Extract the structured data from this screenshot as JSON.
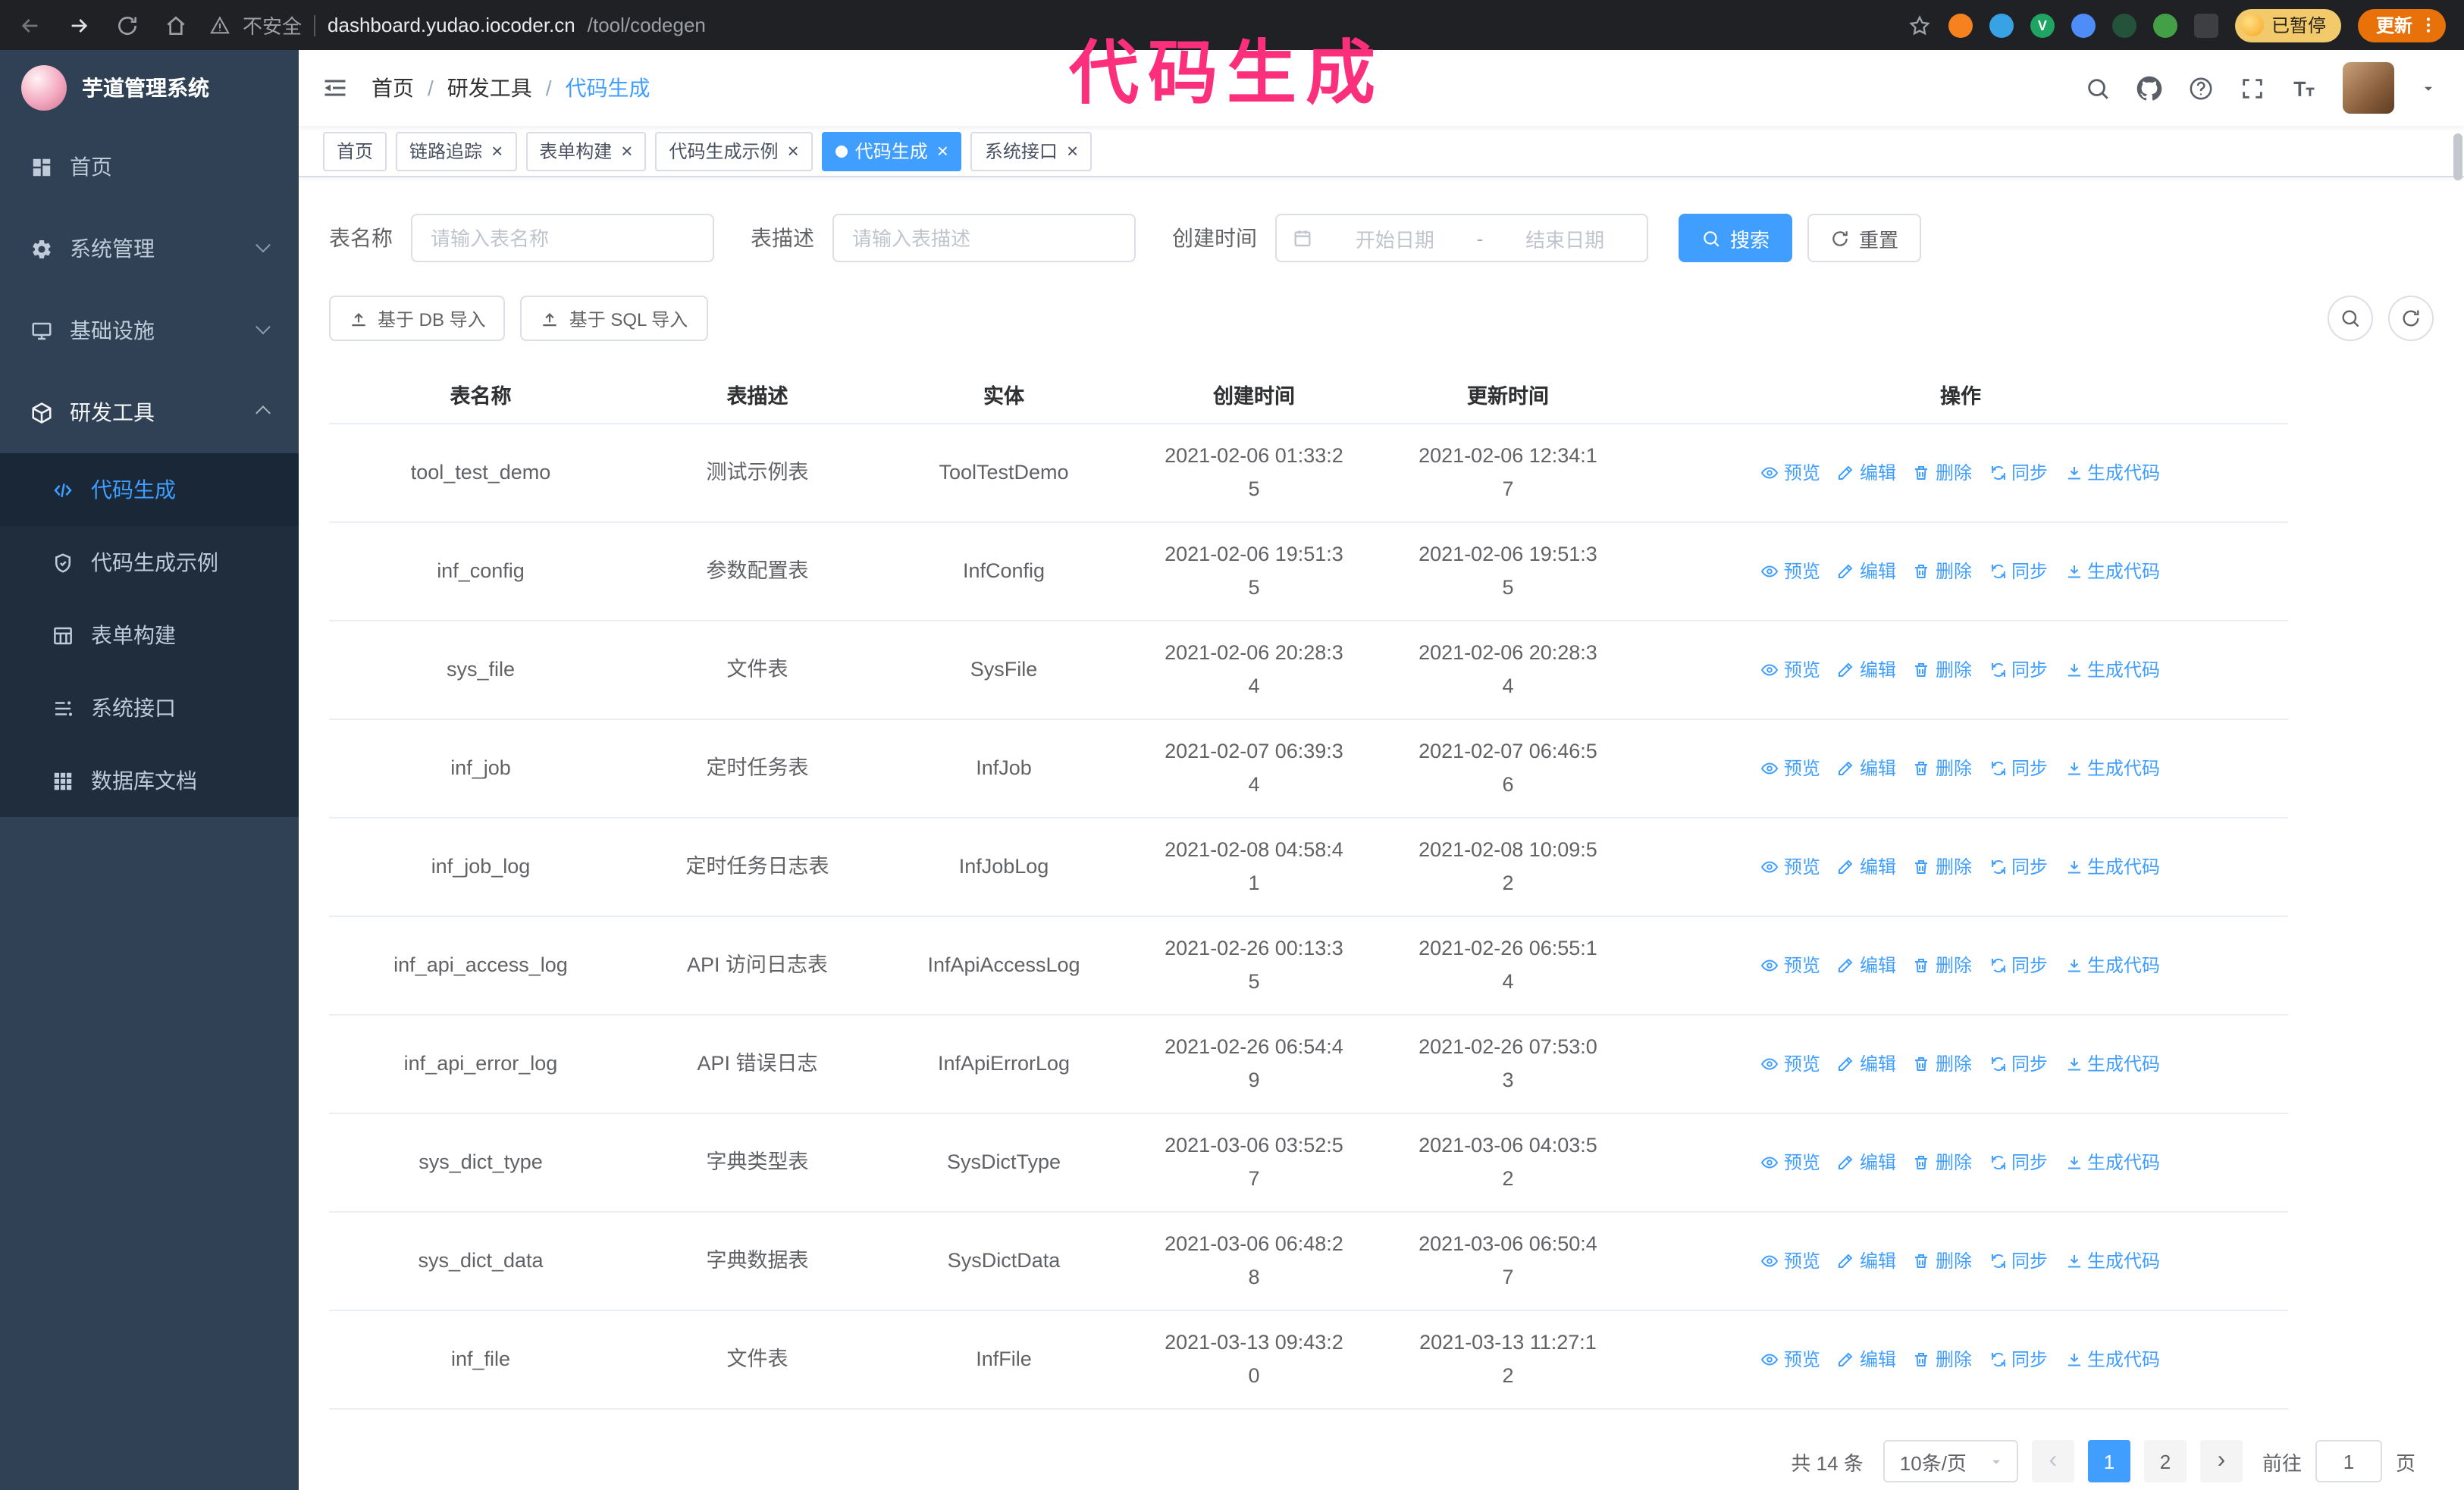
{
  "annotation": {
    "text": "代码生成"
  },
  "browser": {
    "security_label": "不安全",
    "url_host": "dashboard.yudao.iocoder.cn",
    "url_path": "/tool/codegen",
    "paused_badge": "已暂停",
    "update_label": "更新"
  },
  "sidebar": {
    "title": "芋道管理系统",
    "items": [
      {
        "label": "首页",
        "icon": "home-icon",
        "expandable": false,
        "expanded": false
      },
      {
        "label": "系统管理",
        "icon": "gear-icon",
        "expandable": true,
        "expanded": false
      },
      {
        "label": "基础设施",
        "icon": "infra-icon",
        "expandable": true,
        "expanded": false
      },
      {
        "label": "研发工具",
        "icon": "tools-icon",
        "expandable": true,
        "expanded": true
      }
    ],
    "subitems": [
      {
        "label": "代码生成",
        "icon": "code-icon",
        "active": true
      },
      {
        "label": "代码生成示例",
        "icon": "shield-icon",
        "active": false
      },
      {
        "label": "表单构建",
        "icon": "form-icon",
        "active": false
      },
      {
        "label": "系统接口",
        "icon": "api-icon",
        "active": false
      },
      {
        "label": "数据库文档",
        "icon": "grid-icon",
        "active": false
      }
    ]
  },
  "header": {
    "breadcrumb": [
      "首页",
      "研发工具",
      "代码生成"
    ]
  },
  "tabs": [
    {
      "label": "首页",
      "closable": false,
      "active": false
    },
    {
      "label": "链路追踪",
      "closable": true,
      "active": false
    },
    {
      "label": "表单构建",
      "closable": true,
      "active": false
    },
    {
      "label": "代码生成示例",
      "closable": true,
      "active": false
    },
    {
      "label": "代码生成",
      "closable": true,
      "active": true
    },
    {
      "label": "系统接口",
      "closable": true,
      "active": false
    }
  ],
  "filters": {
    "table_name_label": "表名称",
    "table_name_placeholder": "请输入表名称",
    "table_desc_label": "表描述",
    "table_desc_placeholder": "请输入表描述",
    "create_time_label": "创建时间",
    "date_start_placeholder": "开始日期",
    "date_separator": "-",
    "date_end_placeholder": "结束日期",
    "search_button": "搜索",
    "reset_button": "重置"
  },
  "toolbar": {
    "db_import": "基于 DB 导入",
    "sql_import": "基于 SQL 导入"
  },
  "table": {
    "columns": [
      "表名称",
      "表描述",
      "实体",
      "创建时间",
      "更新时间",
      "操作"
    ],
    "actions": [
      "预览",
      "编辑",
      "删除",
      "同步",
      "生成代码"
    ],
    "rows": [
      {
        "name": "tool_test_demo",
        "desc": "测试示例表",
        "entity": "ToolTestDemo",
        "created": "2021-02-06 01:33:25",
        "updated": "2021-02-06 12:34:17"
      },
      {
        "name": "inf_config",
        "desc": "参数配置表",
        "entity": "InfConfig",
        "created": "2021-02-06 19:51:35",
        "updated": "2021-02-06 19:51:35"
      },
      {
        "name": "sys_file",
        "desc": "文件表",
        "entity": "SysFile",
        "created": "2021-02-06 20:28:34",
        "updated": "2021-02-06 20:28:34"
      },
      {
        "name": "inf_job",
        "desc": "定时任务表",
        "entity": "InfJob",
        "created": "2021-02-07 06:39:34",
        "updated": "2021-02-07 06:46:56"
      },
      {
        "name": "inf_job_log",
        "desc": "定时任务日志表",
        "entity": "InfJobLog",
        "created": "2021-02-08 04:58:41",
        "updated": "2021-02-08 10:09:52"
      },
      {
        "name": "inf_api_access_log",
        "desc": "API 访问日志表",
        "entity": "InfApiAccessLog",
        "created": "2021-02-26 00:13:35",
        "updated": "2021-02-26 06:55:14"
      },
      {
        "name": "inf_api_error_log",
        "desc": "API 错误日志",
        "entity": "InfApiErrorLog",
        "created": "2021-02-26 06:54:49",
        "updated": "2021-02-26 07:53:03"
      },
      {
        "name": "sys_dict_type",
        "desc": "字典类型表",
        "entity": "SysDictType",
        "created": "2021-03-06 03:52:57",
        "updated": "2021-03-06 04:03:52"
      },
      {
        "name": "sys_dict_data",
        "desc": "字典数据表",
        "entity": "SysDictData",
        "created": "2021-03-06 06:48:28",
        "updated": "2021-03-06 06:50:47"
      },
      {
        "name": "inf_file",
        "desc": "文件表",
        "entity": "InfFile",
        "created": "2021-03-13 09:43:20",
        "updated": "2021-03-13 11:27:12"
      }
    ]
  },
  "pagination": {
    "total": "共 14 条",
    "page_size": "10条/页",
    "pages": [
      "1",
      "2"
    ],
    "active_page": "1",
    "goto_label": "前往",
    "goto_value": "1",
    "goto_suffix": "页"
  }
}
